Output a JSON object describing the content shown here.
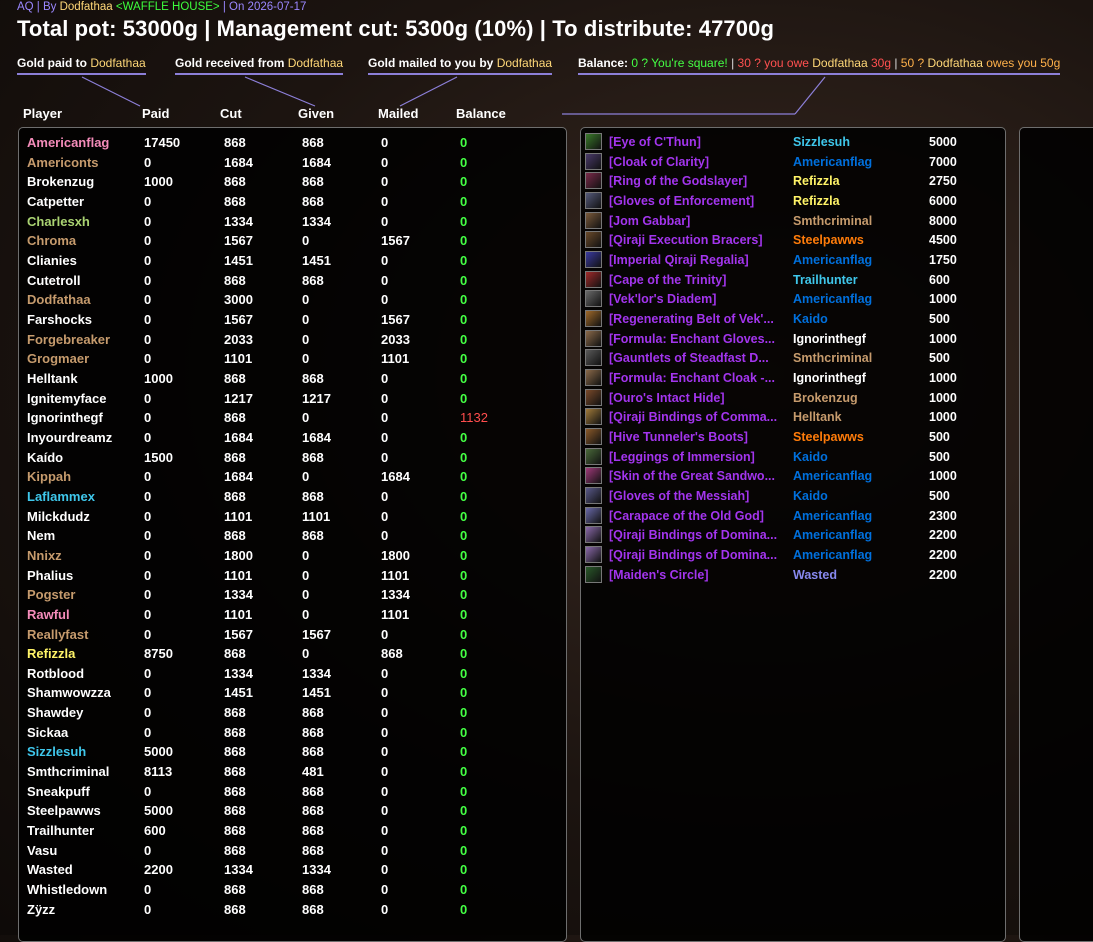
{
  "header": {
    "subtitle_prefix": "AQ | By ",
    "subtitle_name": "Dodfathaa",
    "subtitle_guild": "<WAFFLE HOUSE>",
    "subtitle_date": " | On 2026-07-17",
    "title": "Total pot: 53000g | Management cut: 5300g (10%) | To distribute: 47700g"
  },
  "legend": {
    "paid_label": "Gold paid to ",
    "received_label": "Gold received from ",
    "mailed_label": "Gold mailed to you by ",
    "name": "Dodfathaa",
    "balance_label": "Balance: ",
    "balance_zero": "0 ? You're square!",
    "balance_sep": " | ",
    "balance_neg": "30 ? you owe ",
    "balance_neg_amt": " 30g",
    "balance_pos": "50 ? ",
    "balance_pos_tail": " owes you 50g"
  },
  "columns": [
    "Player",
    "Paid",
    "Cut",
    "Given",
    "Mailed",
    "Balance"
  ],
  "colors": {
    "druid": "#ff7c0a",
    "hunter": "#aad372",
    "mage": "#3fc7eb",
    "paladin": "#f48cba",
    "priest": "#ffffff",
    "rogue": "#fff468",
    "shaman": "#0070dd",
    "warlock": "#8788ee",
    "warrior": "#c69b6d",
    "epic": "#a335ee",
    "balance_ok": "#44ff44",
    "balance_bad": "#ff4d4d"
  },
  "players": [
    {
      "name": "Americanflag",
      "paid": "17450",
      "cut": "868",
      "given": "868",
      "mailed": "0",
      "balance": "0",
      "cls": "paladin"
    },
    {
      "name": "Americonts",
      "paid": "0",
      "cut": "1684",
      "given": "1684",
      "mailed": "0",
      "balance": "0",
      "cls": "warrior"
    },
    {
      "name": "Brokenzug",
      "paid": "1000",
      "cut": "868",
      "given": "868",
      "mailed": "0",
      "balance": "0",
      "cls": "priest"
    },
    {
      "name": "Catpetter",
      "paid": "0",
      "cut": "868",
      "given": "868",
      "mailed": "0",
      "balance": "0",
      "cls": "priest"
    },
    {
      "name": "Charlesxh",
      "paid": "0",
      "cut": "1334",
      "given": "1334",
      "mailed": "0",
      "balance": "0",
      "cls": "hunter"
    },
    {
      "name": "Chroma",
      "paid": "0",
      "cut": "1567",
      "given": "0",
      "mailed": "1567",
      "balance": "0",
      "cls": "warrior"
    },
    {
      "name": "Clianies",
      "paid": "0",
      "cut": "1451",
      "given": "1451",
      "mailed": "0",
      "balance": "0",
      "cls": "priest"
    },
    {
      "name": "Cutetroll",
      "paid": "0",
      "cut": "868",
      "given": "868",
      "mailed": "0",
      "balance": "0",
      "cls": "priest"
    },
    {
      "name": "Dodfathaa",
      "paid": "0",
      "cut": "3000",
      "given": "0",
      "mailed": "0",
      "balance": "0",
      "cls": "warrior"
    },
    {
      "name": "Farshocks",
      "paid": "0",
      "cut": "1567",
      "given": "0",
      "mailed": "1567",
      "balance": "0",
      "cls": "priest"
    },
    {
      "name": "Forgebreaker",
      "paid": "0",
      "cut": "2033",
      "given": "0",
      "mailed": "2033",
      "balance": "0",
      "cls": "warrior"
    },
    {
      "name": "Grogmaer",
      "paid": "0",
      "cut": "1101",
      "given": "0",
      "mailed": "1101",
      "balance": "0",
      "cls": "warrior"
    },
    {
      "name": "Helltank",
      "paid": "1000",
      "cut": "868",
      "given": "868",
      "mailed": "0",
      "balance": "0",
      "cls": "priest"
    },
    {
      "name": "Ignitemyface",
      "paid": "0",
      "cut": "1217",
      "given": "1217",
      "mailed": "0",
      "balance": "0",
      "cls": "priest"
    },
    {
      "name": "Ignorinthegf",
      "paid": "0",
      "cut": "868",
      "given": "0",
      "mailed": "0",
      "balance": "1132",
      "cls": "priest"
    },
    {
      "name": "Inyourdreamz",
      "paid": "0",
      "cut": "1684",
      "given": "1684",
      "mailed": "0",
      "balance": "0",
      "cls": "priest"
    },
    {
      "name": "Kaído",
      "paid": "1500",
      "cut": "868",
      "given": "868",
      "mailed": "0",
      "balance": "0",
      "cls": "priest"
    },
    {
      "name": "Kippah",
      "paid": "0",
      "cut": "1684",
      "given": "0",
      "mailed": "1684",
      "balance": "0",
      "cls": "warrior"
    },
    {
      "name": "Laflammex",
      "paid": "0",
      "cut": "868",
      "given": "868",
      "mailed": "0",
      "balance": "0",
      "cls": "mage"
    },
    {
      "name": "Milckdudz",
      "paid": "0",
      "cut": "1101",
      "given": "1101",
      "mailed": "0",
      "balance": "0",
      "cls": "priest"
    },
    {
      "name": "Nem",
      "paid": "0",
      "cut": "868",
      "given": "868",
      "mailed": "0",
      "balance": "0",
      "cls": "priest"
    },
    {
      "name": "Nnixz",
      "paid": "0",
      "cut": "1800",
      "given": "0",
      "mailed": "1800",
      "balance": "0",
      "cls": "warrior"
    },
    {
      "name": "Phalius",
      "paid": "0",
      "cut": "1101",
      "given": "0",
      "mailed": "1101",
      "balance": "0",
      "cls": "priest"
    },
    {
      "name": "Pogster",
      "paid": "0",
      "cut": "1334",
      "given": "0",
      "mailed": "1334",
      "balance": "0",
      "cls": "warrior"
    },
    {
      "name": "Rawful",
      "paid": "0",
      "cut": "1101",
      "given": "0",
      "mailed": "1101",
      "balance": "0",
      "cls": "paladin"
    },
    {
      "name": "Reallyfast",
      "paid": "0",
      "cut": "1567",
      "given": "1567",
      "mailed": "0",
      "balance": "0",
      "cls": "warrior"
    },
    {
      "name": "Refizzla",
      "paid": "8750",
      "cut": "868",
      "given": "0",
      "mailed": "868",
      "balance": "0",
      "cls": "rogue"
    },
    {
      "name": "Rotblood",
      "paid": "0",
      "cut": "1334",
      "given": "1334",
      "mailed": "0",
      "balance": "0",
      "cls": "priest"
    },
    {
      "name": "Shamwowzza",
      "paid": "0",
      "cut": "1451",
      "given": "1451",
      "mailed": "0",
      "balance": "0",
      "cls": "priest"
    },
    {
      "name": "Shawdey",
      "paid": "0",
      "cut": "868",
      "given": "868",
      "mailed": "0",
      "balance": "0",
      "cls": "priest"
    },
    {
      "name": "Sickaa",
      "paid": "0",
      "cut": "868",
      "given": "868",
      "mailed": "0",
      "balance": "0",
      "cls": "priest"
    },
    {
      "name": "Sizzlesuh",
      "paid": "5000",
      "cut": "868",
      "given": "868",
      "mailed": "0",
      "balance": "0",
      "cls": "mage"
    },
    {
      "name": "Smthcriminal",
      "paid": "8113",
      "cut": "868",
      "given": "481",
      "mailed": "0",
      "balance": "0",
      "cls": "priest"
    },
    {
      "name": "Sneakpuff",
      "paid": "0",
      "cut": "868",
      "given": "868",
      "mailed": "0",
      "balance": "0",
      "cls": "priest"
    },
    {
      "name": "Steelpawws",
      "paid": "5000",
      "cut": "868",
      "given": "868",
      "mailed": "0",
      "balance": "0",
      "cls": "priest"
    },
    {
      "name": "Trailhunter",
      "paid": "600",
      "cut": "868",
      "given": "868",
      "mailed": "0",
      "balance": "0",
      "cls": "priest"
    },
    {
      "name": "Vasu",
      "paid": "0",
      "cut": "868",
      "given": "868",
      "mailed": "0",
      "balance": "0",
      "cls": "priest"
    },
    {
      "name": "Wasted",
      "paid": "2200",
      "cut": "1334",
      "given": "1334",
      "mailed": "0",
      "balance": "0",
      "cls": "priest"
    },
    {
      "name": "Whistledown",
      "paid": "0",
      "cut": "868",
      "given": "868",
      "mailed": "0",
      "balance": "0",
      "cls": "priest"
    },
    {
      "name": "Zÿzz",
      "paid": "0",
      "cut": "868",
      "given": "868",
      "mailed": "0",
      "balance": "0",
      "cls": "priest"
    }
  ],
  "loot": [
    {
      "item": "[Eye of C'Thun]",
      "winner": "Sizzlesuh",
      "price": "5000",
      "wcls": "mage",
      "icon": "#3a7a2a"
    },
    {
      "item": "[Cloak of Clarity]",
      "winner": "Americanflag",
      "price": "7000",
      "wcls": "shaman",
      "icon": "#4a3a6a"
    },
    {
      "item": "[Ring of the Godslayer]",
      "winner": "Refizzla",
      "price": "2750",
      "wcls": "rogue",
      "icon": "#7a2a4a"
    },
    {
      "item": "[Gloves of Enforcement]",
      "winner": "Refizzla",
      "price": "6000",
      "wcls": "rogue",
      "icon": "#555a7a"
    },
    {
      "item": "[Jom Gabbar]",
      "winner": "Smthcriminal",
      "price": "8000",
      "wcls": "warrior",
      "icon": "#7a5a3a"
    },
    {
      "item": "[Qiraji Execution Bracers]",
      "winner": "Steelpawws",
      "price": "4500",
      "wcls": "druid",
      "icon": "#6a4a2a"
    },
    {
      "item": "[Imperial Qiraji Regalia]",
      "winner": "Americanflag",
      "price": "1750",
      "wcls": "shaman",
      "icon": "#3a3aa0"
    },
    {
      "item": "[Cape of the Trinity]",
      "winner": "Trailhunter",
      "price": "600",
      "wcls": "mage",
      "icon": "#a02a2a"
    },
    {
      "item": "[Vek'lor's Diadem]",
      "winner": "Americanflag",
      "price": "1000",
      "wcls": "shaman",
      "icon": "#6a6a6a"
    },
    {
      "item": "[Regenerating Belt of Vek'...",
      "winner": "Kaido",
      "price": "500",
      "wcls": "shaman",
      "icon": "#a06a2a"
    },
    {
      "item": "[Formula: Enchant Gloves...",
      "winner": "Ignorinthegf",
      "price": "1000",
      "wcls": "priest",
      "icon": "#8a6a4a"
    },
    {
      "item": "[Gauntlets of Steadfast D...",
      "winner": "Smthcriminal",
      "price": "500",
      "wcls": "warrior",
      "icon": "#5a5a5a"
    },
    {
      "item": "[Formula: Enchant Cloak -...",
      "winner": "Ignorinthegf",
      "price": "1000",
      "wcls": "priest",
      "icon": "#8a6a4a"
    },
    {
      "item": "[Ouro's Intact Hide]",
      "winner": "Brokenzug",
      "price": "1000",
      "wcls": "warrior",
      "icon": "#7a4a2a"
    },
    {
      "item": "[Qiraji Bindings of Comma...",
      "winner": "Helltank",
      "price": "1000",
      "wcls": "warrior",
      "icon": "#a07a3a"
    },
    {
      "item": "[Hive Tunneler's Boots]",
      "winner": "Steelpawws",
      "price": "500",
      "wcls": "druid",
      "icon": "#8a5a2a"
    },
    {
      "item": "[Leggings of Immersion]",
      "winner": "Kaido",
      "price": "500",
      "wcls": "shaman",
      "icon": "#4a6a3a"
    },
    {
      "item": "[Skin of the Great Sandwo...",
      "winner": "Americanflag",
      "price": "1000",
      "wcls": "shaman",
      "icon": "#a03a7a"
    },
    {
      "item": "[Gloves of the Messiah]",
      "winner": "Kaido",
      "price": "500",
      "wcls": "shaman",
      "icon": "#5a5a8a"
    },
    {
      "item": "[Carapace of the Old God]",
      "winner": "Americanflag",
      "price": "2300",
      "wcls": "shaman",
      "icon": "#6a6aaa"
    },
    {
      "item": "[Qiraji Bindings of Domina...",
      "winner": "Americanflag",
      "price": "2200",
      "wcls": "shaman",
      "icon": "#8a6aaa"
    },
    {
      "item": "[Qiraji Bindings of Domina...",
      "winner": "Americanflag",
      "price": "2200",
      "wcls": "shaman",
      "icon": "#8a6aaa"
    },
    {
      "item": "[Maiden's Circle]",
      "winner": "Wasted",
      "price": "2200",
      "wcls": "warlock",
      "icon": "#2a5a2a"
    }
  ]
}
